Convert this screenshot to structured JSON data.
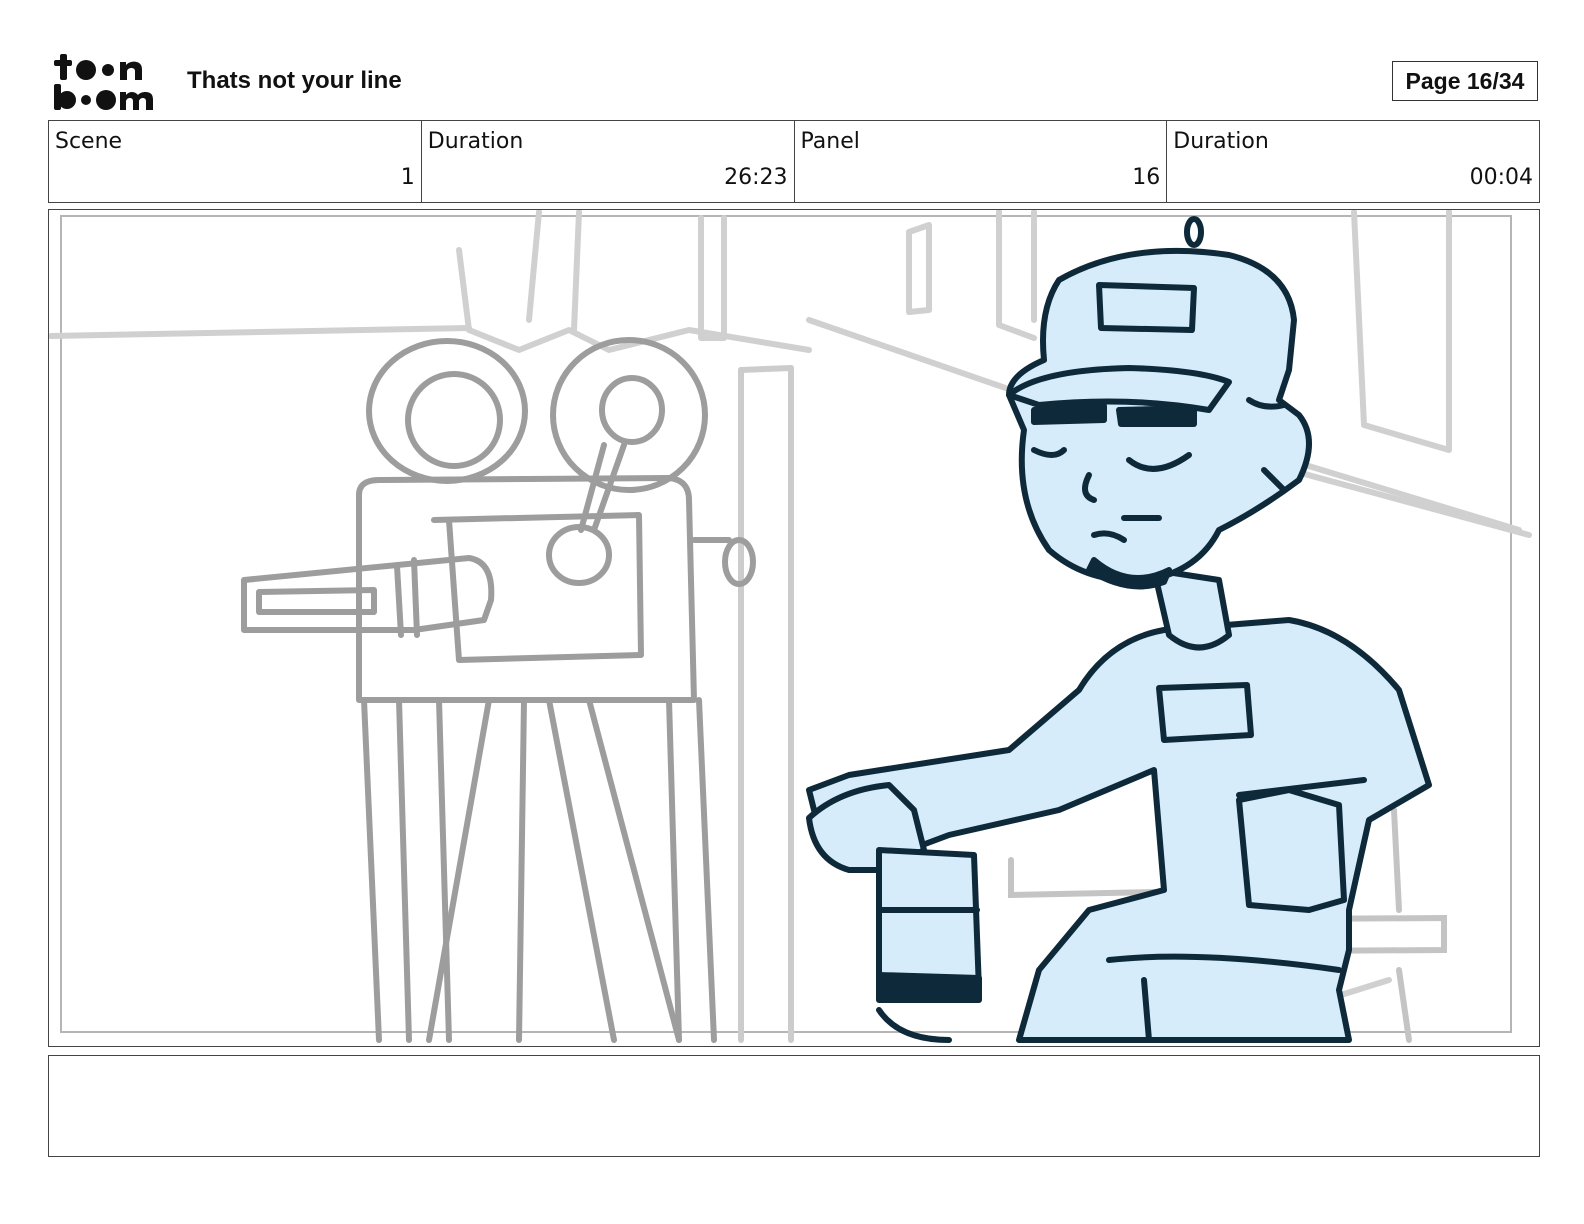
{
  "header": {
    "logo_text": "toon boom",
    "title": "Thats not your line",
    "page": "Page 16/34"
  },
  "info": {
    "scene_label": "Scene",
    "scene_value": "1",
    "scene_duration_label": "Duration",
    "scene_duration_value": "26:23",
    "panel_label": "Panel",
    "panel_value": "16",
    "panel_duration_label": "Duration",
    "panel_duration_value": "00:04"
  },
  "panel": {
    "image": "sketch of a vintage film camera on a tripod beside a seated man in a cap holding a drink",
    "colors": {
      "sketch_gray": "#9d9d9d",
      "character_fill": "#d6ecfa",
      "ink": "#0e2a3a"
    }
  },
  "notes": {
    "text": ""
  }
}
